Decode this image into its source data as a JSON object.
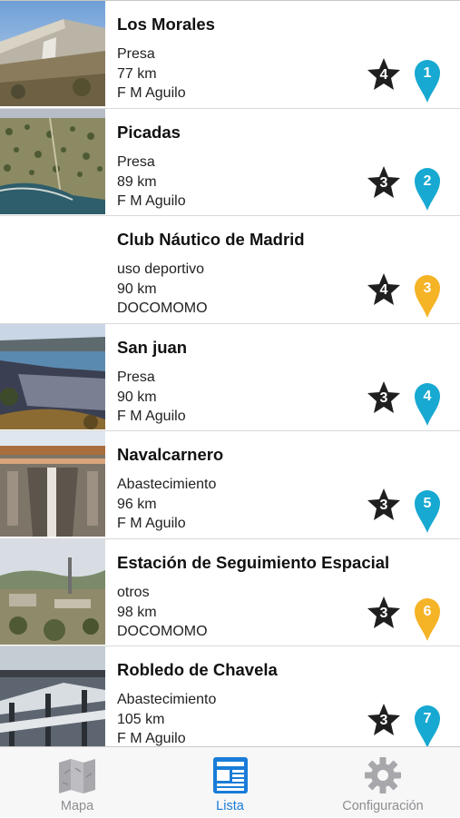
{
  "items": [
    {
      "title": "Los Morales",
      "category": "Presa",
      "distance": "77 km",
      "author": "F M Aguilo",
      "rating": "4",
      "number": "1",
      "pin_color": "#17a9d1",
      "thumb": "dam"
    },
    {
      "title": "Picadas",
      "category": "Presa",
      "distance": "89 km",
      "author": "F M Aguilo",
      "rating": "3",
      "number": "2",
      "pin_color": "#17a9d1",
      "thumb": "aerial"
    },
    {
      "title": "Club Náutico de Madrid",
      "category": "uso deportivo",
      "distance": "90 km",
      "author": "DOCOMOMO",
      "rating": "4",
      "number": "3",
      "pin_color": "#f5b326",
      "thumb": "none"
    },
    {
      "title": "San juan",
      "category": "Presa",
      "distance": "90 km",
      "author": "F M Aguilo",
      "rating": "3",
      "number": "4",
      "pin_color": "#17a9d1",
      "thumb": "reservoir"
    },
    {
      "title": "Navalcarnero",
      "category": "Abastecimiento",
      "distance": "96 km",
      "author": "F M Aguilo",
      "rating": "3",
      "number": "5",
      "pin_color": "#17a9d1",
      "thumb": "plant"
    },
    {
      "title": "Estación de Seguimiento Espacial",
      "category": "otros",
      "distance": "98 km",
      "author": "DOCOMOMO",
      "rating": "3",
      "number": "6",
      "pin_color": "#f5b326",
      "thumb": "station"
    },
    {
      "title": "Robledo de Chavela",
      "category": "Abastecimiento",
      "distance": "105 km",
      "author": "F M Aguilo",
      "rating": "3",
      "number": "7",
      "pin_color": "#17a9d1",
      "thumb": "tanks"
    }
  ],
  "tabs": {
    "mapa": {
      "label": "Mapa",
      "icon": "map-icon"
    },
    "lista": {
      "label": "Lista",
      "icon": "list-icon"
    },
    "config": {
      "label": "Configuración",
      "icon": "gear-icon"
    }
  },
  "colors": {
    "accent": "#1a7cd8",
    "inactive": "#8e8e93",
    "pin_blue": "#17a9d1",
    "pin_orange": "#f5b326"
  }
}
